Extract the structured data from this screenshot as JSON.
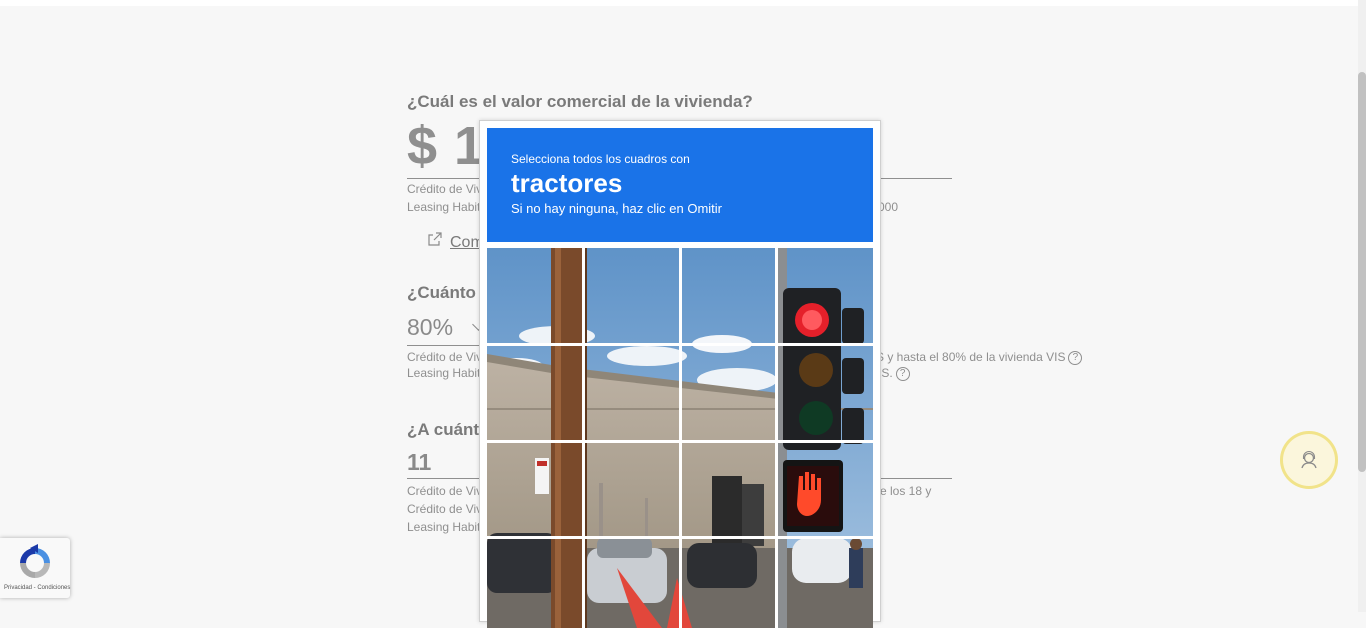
{
  "form": {
    "q1": {
      "title": "¿Cuál es el valor comercial de la vivienda?",
      "value": "$ 1",
      "note1": "Crédito de Viv",
      "note2": "Leasing Habit",
      "note2_tail": "000",
      "link": "Com"
    },
    "q2": {
      "title": "¿Cuánto d",
      "value": "80%",
      "note1": "Crédito de Viv",
      "note1_tail": "S y hasta el 80% de la vivienda VIS",
      "note2": "Leasing Habit",
      "note2_tail": "IS.",
      "help_glyph": "?"
    },
    "q3": {
      "title": "¿A cuánto",
      "value": "11",
      "note1": "Crédito de Viv",
      "note1_tail": "re los 18 y",
      "note2": "Crédito de Viv",
      "note3": "Leasing Habit"
    }
  },
  "captcha": {
    "instruction": "Selecciona todos los cuadros con",
    "object": "tractores",
    "hint": "Si no hay ninguna, haz clic en Omitir",
    "header_color": "#1a73e8",
    "grid_rows": 4,
    "grid_cols": 4
  },
  "badge": {
    "text": "Privacidad - Condiciones"
  },
  "colors": {
    "accent_yellow": "#f1e38a",
    "text_gray": "#8a8a8a"
  }
}
